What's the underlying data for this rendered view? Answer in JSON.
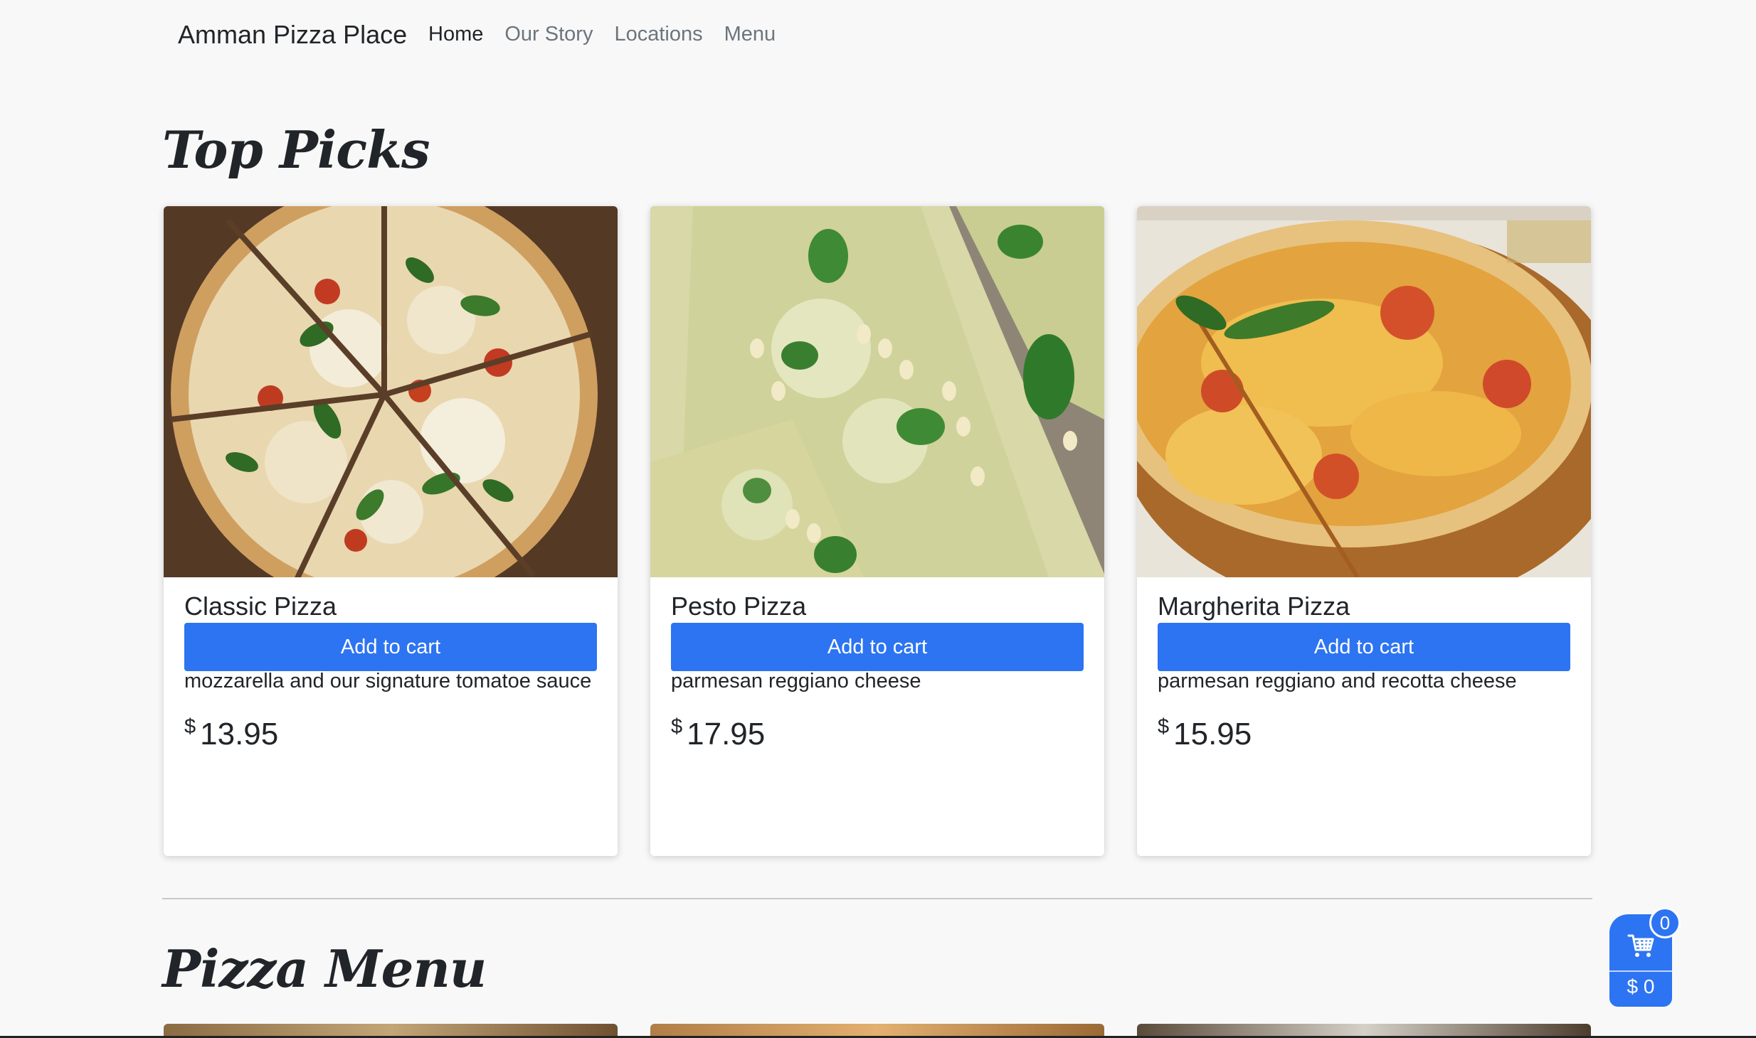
{
  "navbar": {
    "brand": "Amman Pizza Place",
    "links": [
      {
        "label": "Home",
        "active": true
      },
      {
        "label": "Our Story",
        "active": false
      },
      {
        "label": "Locations",
        "active": false
      },
      {
        "label": "Menu",
        "active": false
      }
    ]
  },
  "sections": {
    "top_picks_title": "Top Picks",
    "pizza_menu_title": "Pizza Menu"
  },
  "top_picks": [
    {
      "name": "Classic Pizza",
      "description": "Taste our delicious classic with basil, mozzarella and our signature tomatoe sauce",
      "currency": "$",
      "price": "13.95",
      "button_label": "Add to cart"
    },
    {
      "name": "Pesto Pizza",
      "description": "Taste our delicious classic with pesto sauce, parmesan reggiano cheese",
      "currency": "$",
      "price": "17.95",
      "button_label": "Add to cart"
    },
    {
      "name": "Margherita Pizza",
      "description": "Delicious margherita with mozzarella, parmesan reggiano and recotta cheese",
      "currency": "$",
      "price": "15.95",
      "button_label": "Add to cart"
    }
  ],
  "cart": {
    "count": "0",
    "total": "$ 0",
    "icon": "cart-icon"
  },
  "colors": {
    "primary": "#2c74f1",
    "background": "#f8f8f8",
    "text": "#212529",
    "muted_nav": "#6c757d"
  }
}
